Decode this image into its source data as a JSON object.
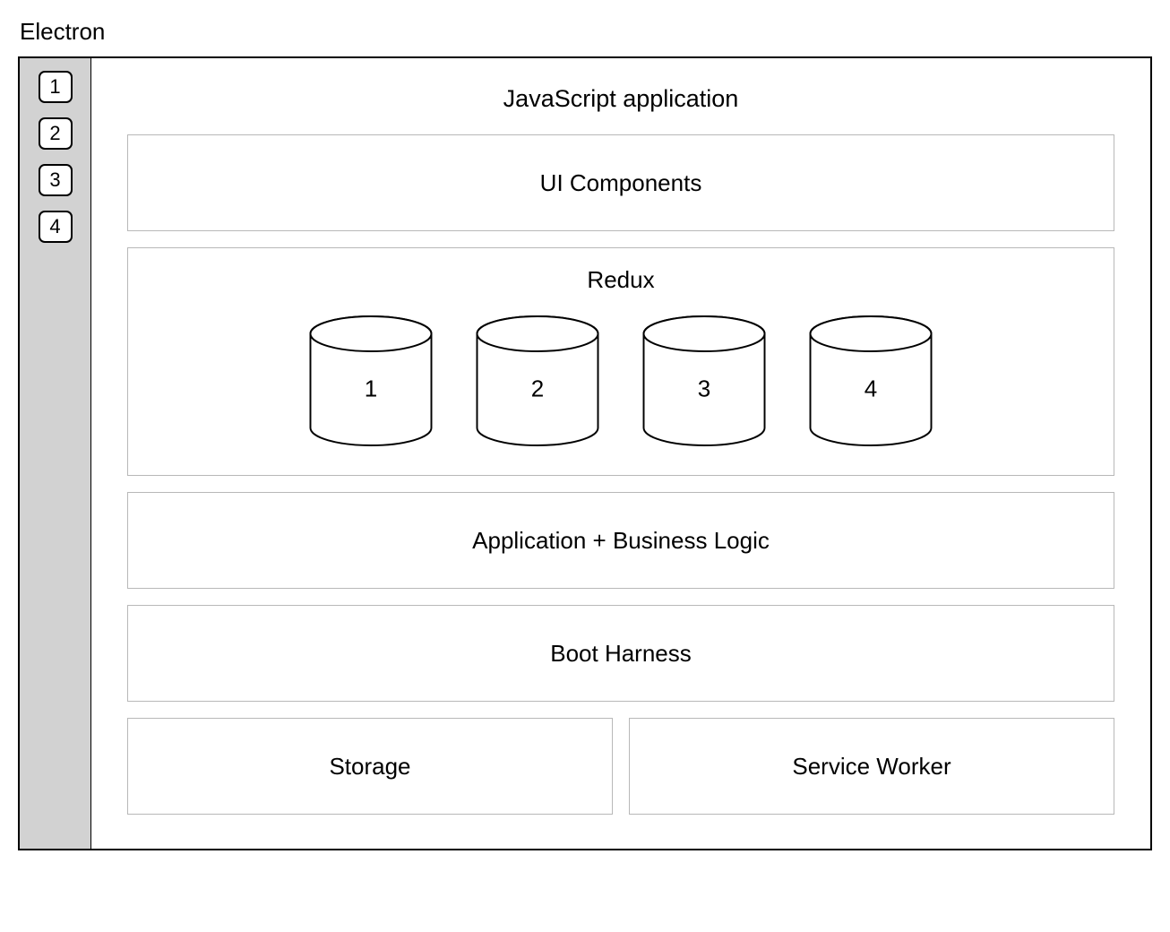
{
  "title": "Electron",
  "sidebar": {
    "items": [
      {
        "label": "1"
      },
      {
        "label": "2"
      },
      {
        "label": "3"
      },
      {
        "label": "4"
      }
    ]
  },
  "main": {
    "title": "JavaScript application",
    "layers": {
      "ui_components": "UI Components",
      "redux": {
        "title": "Redux",
        "stores": [
          {
            "label": "1"
          },
          {
            "label": "2"
          },
          {
            "label": "3"
          },
          {
            "label": "4"
          }
        ]
      },
      "app_logic": "Application + Business Logic",
      "boot_harness": "Boot Harness",
      "storage": "Storage",
      "service_worker": "Service Worker"
    }
  }
}
